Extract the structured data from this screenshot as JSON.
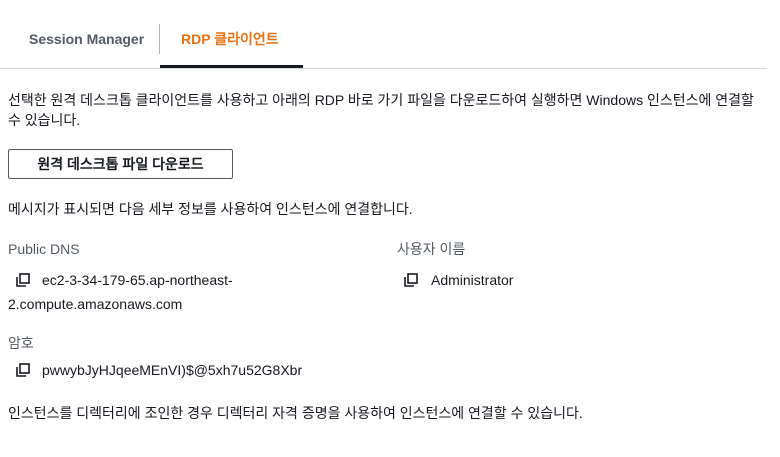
{
  "tabs": {
    "session_manager": "Session Manager",
    "rdp_client": "RDP 클라이언트"
  },
  "description": "선택한 원격 데스크톱 클라이언트를 사용하고 아래의 RDP 바로 가기 파일을 다운로드하여 실행하면 Windows 인스턴스에 연결할 수 있습니다.",
  "download_button": "원격 데스크톱 파일 다운로드",
  "prompt_text": "메시지가 표시되면 다음 세부 정보를 사용하여 인스턴스에 연결합니다.",
  "public_dns": {
    "label": "Public DNS",
    "value_line1": "ec2-3-34-179-65.ap-northeast-",
    "value_line2": "2.compute.amazonaws.com"
  },
  "username": {
    "label": "사용자 이름",
    "value": "Administrator"
  },
  "password": {
    "label": "암호",
    "value": "pwwybJyHJqeeMEnVI)$@5xh7u52G8Xbr"
  },
  "footer_text": "인스턴스를 디렉터리에 조인한 경우 디렉터리 자격 증명을 사용하여 인스턴스에 연결할 수 있습니다.",
  "icons": {
    "copy": "copy-icon"
  },
  "colors": {
    "active_tab": "#ec7211",
    "text": "#16191f",
    "secondary_text": "#545b64"
  }
}
